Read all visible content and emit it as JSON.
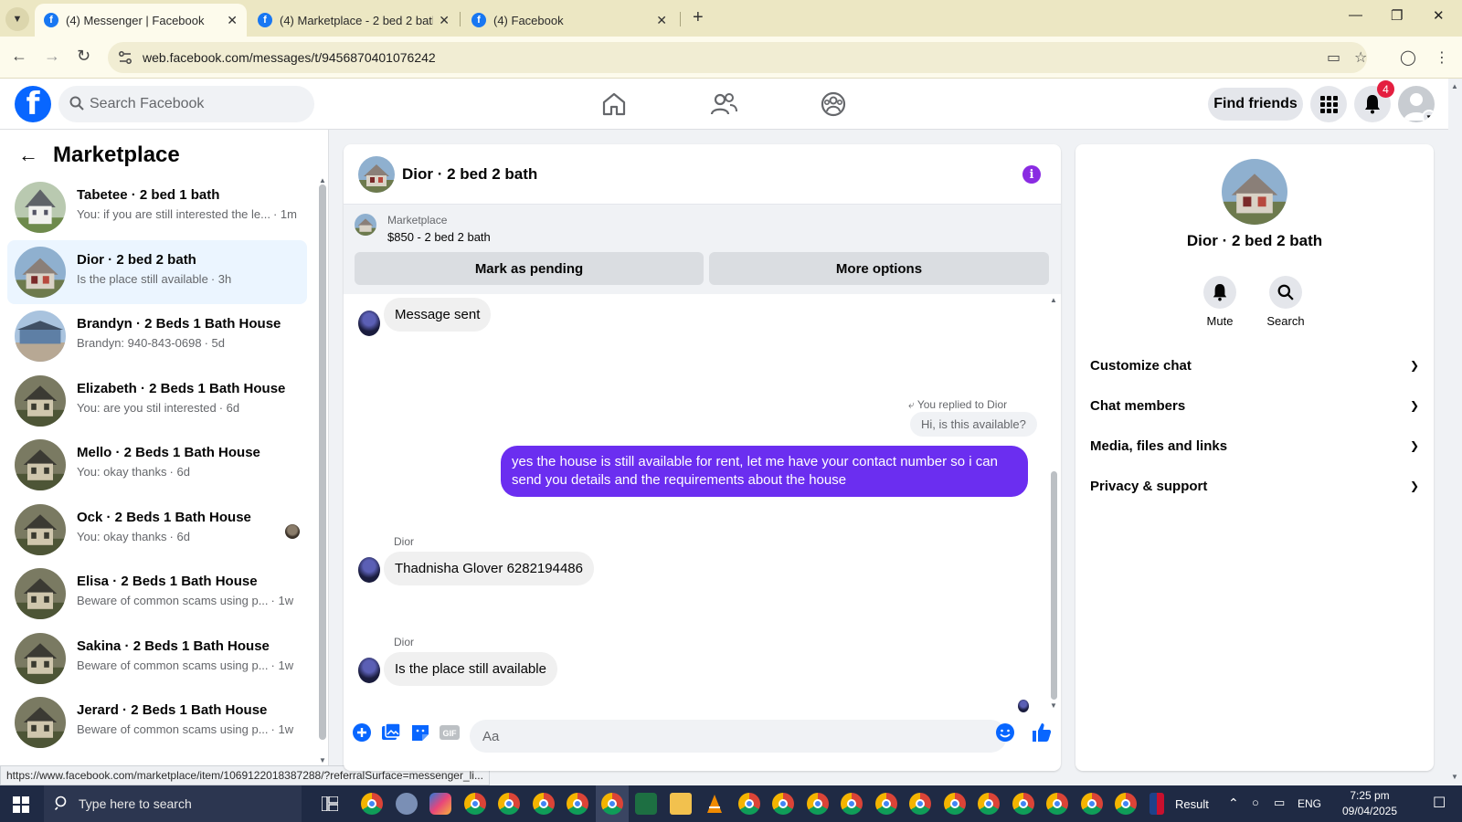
{
  "browser": {
    "tabs": [
      {
        "title": "(4) Messenger | Facebook",
        "active": true
      },
      {
        "title": "(4) Marketplace - 2 bed 2 bath",
        "active": false
      },
      {
        "title": "(4) Facebook",
        "active": false
      }
    ],
    "url": "web.facebook.com/messages/t/9456870401076242",
    "status_url": "https://www.facebook.com/marketplace/item/1069122018387288/?referralSurface=messenger_li..."
  },
  "fb_header": {
    "search_placeholder": "Search Facebook",
    "find_friends_label": "Find friends",
    "notification_count": "4"
  },
  "sidebar": {
    "title": "Marketplace",
    "conversations": [
      {
        "name": "Tabetee · 2 bed 1 bath",
        "preview": "You: if you are still interested the le...",
        "time": "· 1m",
        "thumb": "white"
      },
      {
        "name": "Dior · 2 bed 2 bath",
        "preview": "Is the place still available",
        "time": "· 3h",
        "thumb": "dior",
        "selected": true
      },
      {
        "name": "Brandyn · 2 Beds 1 Bath House",
        "preview": "Brandyn: 940-843-0698",
        "time": "· 5d",
        "thumb": "blue"
      },
      {
        "name": "Elizabeth · 2 Beds 1 Bath House",
        "preview": "You: are you stil interested",
        "time": "· 6d",
        "thumb": "tan"
      },
      {
        "name": "Mello · 2 Beds 1 Bath House",
        "preview": "You: okay thanks",
        "time": "· 6d",
        "thumb": "tan"
      },
      {
        "name": "Ock · 2 Beds 1 Bath House",
        "preview": "You: okay thanks",
        "time": "· 6d",
        "thumb": "tan"
      },
      {
        "name": "Elisa · 2 Beds 1 Bath House",
        "preview": "Beware of common scams using p...",
        "time": "· 1w",
        "thumb": "tan"
      },
      {
        "name": "Sakina · 2 Beds 1 Bath House",
        "preview": "Beware of common scams using p...",
        "time": "· 1w",
        "thumb": "tan"
      },
      {
        "name": "Jerard · 2 Beds 1 Bath House",
        "preview": "Beware of common scams using p...",
        "time": "· 1w",
        "thumb": "tan"
      }
    ]
  },
  "chat": {
    "title": "Dior · 2 bed 2 bath",
    "marketplace_label": "Marketplace",
    "listing_price": "$850 - 2 bed 2 bath",
    "mark_pending_label": "Mark as pending",
    "more_options_label": "More options",
    "messages": {
      "sent_notice": "Message sent",
      "reply_note": "You replied to Dior",
      "reply_quote": "Hi, is this available?",
      "outgoing": "yes the house is still available for rent, let me have your contact number so i can send you details and the requirements about the house",
      "sender1": "Dior",
      "incoming1": "Thadnisha Glover 6282194486",
      "sender2": "Dior",
      "incoming2": "Is the place still available"
    },
    "composer_placeholder": "Aa"
  },
  "info_panel": {
    "title": "Dior · 2 bed 2 bath",
    "mute_label": "Mute",
    "search_label": "Search",
    "sections": [
      "Customize chat",
      "Chat members",
      "Media, files and links",
      "Privacy & support"
    ]
  },
  "taskbar": {
    "search_placeholder": "Type here to search",
    "result_label": "Result",
    "language": "ENG",
    "time": "7:25 pm",
    "date": "09/04/2025"
  },
  "colors": {
    "fb_blue": "#0866ff",
    "outgoing_bubble": "#6b2ef0",
    "selected_row": "#ebf5ff",
    "badge_red": "#e41e3f"
  }
}
